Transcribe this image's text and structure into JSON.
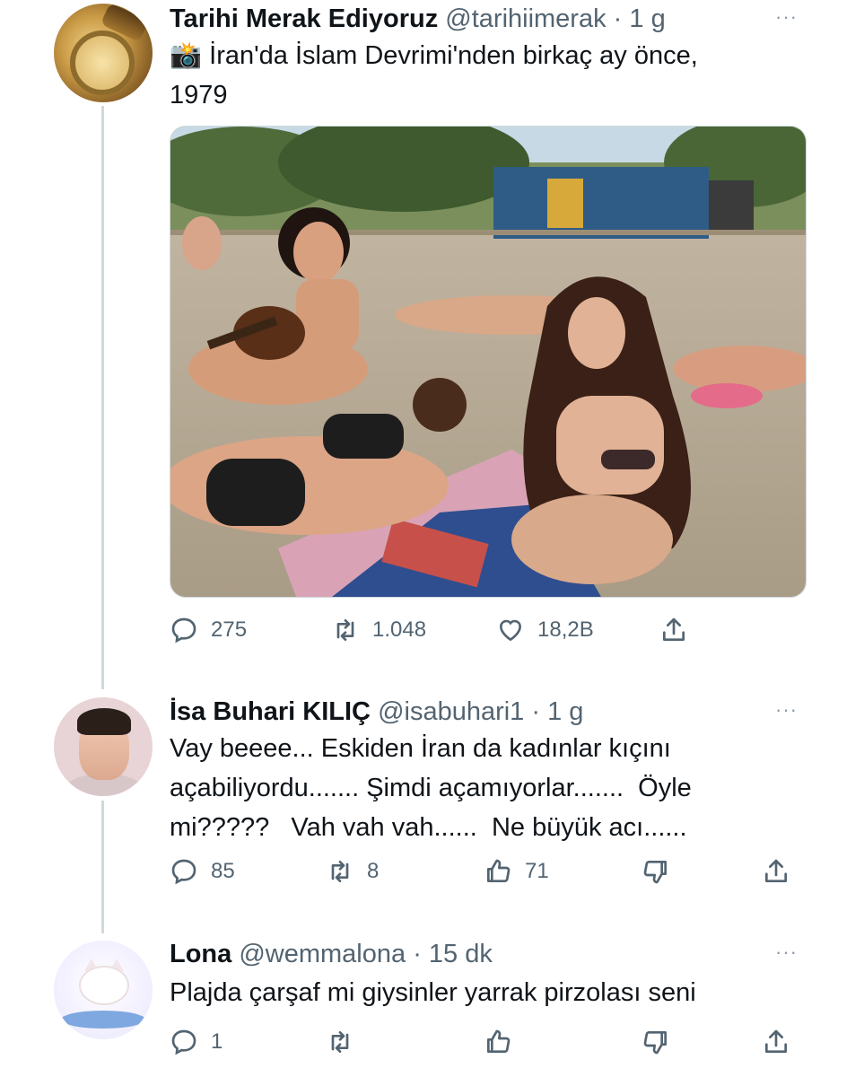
{
  "tweet": {
    "author_name": "Tarihi Merak Ediyoruz",
    "handle": "@tarihiimerak",
    "separator": "·",
    "time": "1 g",
    "more": "···",
    "emoji": "📸",
    "text_line1": "İran'da İslam Devrimi'nden birkaç ay önce,",
    "text_line2": "1979",
    "stats": {
      "replies": "275",
      "retweets": "1.048",
      "likes": "18,2B"
    }
  },
  "reply1": {
    "author_name": "İsa Buhari KILIÇ",
    "handle": "@isabuhari1",
    "separator": "·",
    "time": "1 g",
    "more": "···",
    "text_line1": "Vay beeee... Eskiden İran da kadınlar kıçını",
    "text_line2": "açabiliyordu....... Şimdi açamıyorlar.......  Öyle",
    "text_line3": "mi?????   Vah vah vah......  Ne büyük acı......",
    "stats": {
      "replies": "85",
      "retweets": "8",
      "upvotes": "71"
    }
  },
  "reply2": {
    "author_name": "Lona",
    "handle": "@wemmalona",
    "separator": "·",
    "time": "15 dk",
    "more": "···",
    "text_line1": "Plajda çarşaf mi giysinler yarrak pirzolası seni",
    "stats": {
      "replies": "1"
    }
  },
  "icons": {
    "reply": "reply-icon",
    "retweet": "retweet-icon",
    "like": "heart-icon",
    "share": "share-icon",
    "upvote": "thumbs-up-icon",
    "downvote": "thumbs-down-icon"
  },
  "colors": {
    "text": "#0f1419",
    "secondary": "#536471",
    "thread_line": "#cfd9de"
  }
}
